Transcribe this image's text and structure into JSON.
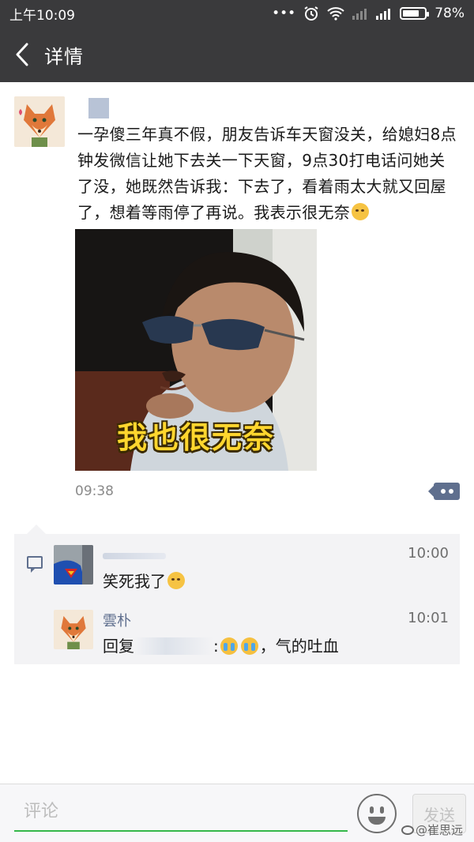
{
  "status_bar": {
    "time": "上午10:09",
    "battery": "78%",
    "battery_level": 0.78
  },
  "nav": {
    "title": "详情"
  },
  "post": {
    "text": "一孕傻三年真不假，朋友告诉车天窗没关，给媳妇8点钟发微信让她下去关一下天窗，9点30打电话问她关了没，她既然告诉我：下去了，看着雨太大就又回屋了，想着等雨停了再说。我表示很无奈",
    "image_caption": "我也很无奈",
    "time": "09:38"
  },
  "comments": [
    {
      "name": "",
      "time": "10:00",
      "text": "笑死我了"
    },
    {
      "name": "雲朴",
      "time": "10:01",
      "reply_prefix": "回复",
      "reply_suffix": ":",
      "text": "，气的吐血"
    }
  ],
  "bottom": {
    "placeholder": "评论",
    "send_label": "发送",
    "watermark": "@崔思远"
  },
  "colors": {
    "header_bg": "#3a3a3c",
    "link_blue": "#5f6f8e",
    "input_underline": "#35b84a",
    "comment_bg": "#f3f3f5"
  },
  "icons": [
    "back-arrow-icon",
    "alarm-icon",
    "wifi-icon",
    "signal-icon",
    "battery-icon",
    "laugh-cry-emoji-icon",
    "comment-icon",
    "more-dots-icon",
    "crying-emoji-icon",
    "emoji-icon",
    "weibo-icon"
  ]
}
